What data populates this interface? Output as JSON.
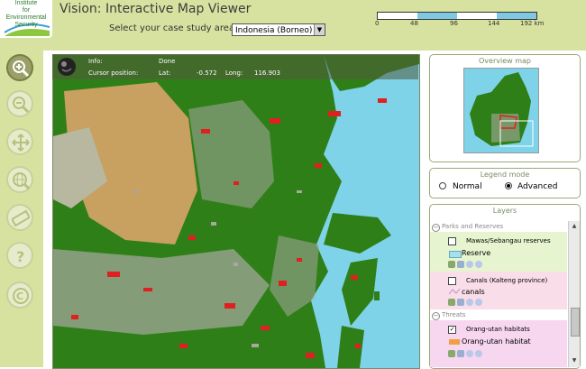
{
  "app": {
    "title": "Vision: Interactive Map Viewer",
    "logo_lines": [
      "Institute",
      "for",
      "Environmental",
      "Security"
    ]
  },
  "case_study": {
    "label": "Select your case study area:",
    "selected": "Indonesia (Borneo)"
  },
  "scale_bar": {
    "ticks": [
      "0",
      "48",
      "96",
      "144",
      "192 km"
    ]
  },
  "toolbar": [
    {
      "name": "zoom-in-tool",
      "icon": "zoom-in-icon",
      "active": true
    },
    {
      "name": "zoom-out-tool",
      "icon": "zoom-out-icon",
      "active": false
    },
    {
      "name": "pan-tool",
      "icon": "pan-icon",
      "active": false
    },
    {
      "name": "zoom-full-tool",
      "icon": "globe-icon",
      "active": false
    },
    {
      "name": "measure-tool",
      "icon": "ruler-icon",
      "active": false
    },
    {
      "name": "help-tool",
      "icon": "help-icon",
      "active": false
    },
    {
      "name": "copyright-tool",
      "icon": "copyright-icon",
      "active": false
    }
  ],
  "map_info": {
    "info_label": "Info:",
    "info_value": "Done",
    "cursor_label": "Cursor position:",
    "lat_label": "Lat:",
    "lat_value": "-0.572",
    "long_label": "Long:",
    "long_value": "116.903"
  },
  "overview": {
    "title": "Overview map"
  },
  "legend_mode": {
    "title": "Legend mode",
    "options": [
      "Normal",
      "Advanced"
    ],
    "selected": "Advanced"
  },
  "layers": {
    "title": "Layers",
    "groups": [
      {
        "name": "Parks and Reserves",
        "color": "#e6f5cf",
        "items": [
          {
            "label": "Mawas/Sebangau reserves",
            "checked": false,
            "legend": "Reserve",
            "swatch": "#a6e0f0"
          }
        ]
      },
      {
        "name": "",
        "color": "#f9dde8",
        "items": [
          {
            "label": "Canals (Kalteng province)",
            "checked": false,
            "legend": "canals",
            "swatch": "#c090c0"
          }
        ]
      },
      {
        "name": "Threats",
        "color": "#f7d6f0",
        "items": [
          {
            "label": "Orang-utan habitats",
            "checked": true,
            "legend": "Orang-utan habitat",
            "swatch": "#f0a040"
          }
        ]
      }
    ]
  },
  "colors": {
    "chrome": "#d8e2a0",
    "sea": "#7fd3e8",
    "forest": "#2f7f18",
    "peat": "#c8a060",
    "cleared": "#a8a8a0",
    "fire": "#e02020"
  }
}
